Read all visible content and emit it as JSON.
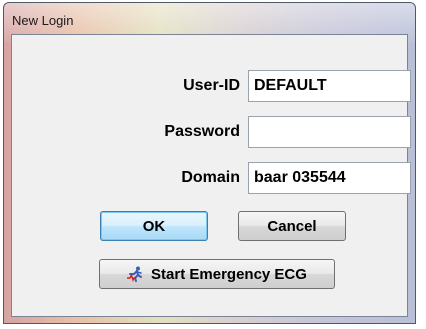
{
  "window": {
    "title": "New Login"
  },
  "form": {
    "userid": {
      "label": "User-ID",
      "value": "DEFAULT"
    },
    "password": {
      "label": "Password",
      "value": ""
    },
    "domain": {
      "label": "Domain",
      "value": "baar 035544"
    }
  },
  "buttons": {
    "ok": "OK",
    "cancel": "Cancel",
    "emergency": "Start Emergency ECG"
  },
  "icons": {
    "emergency": "ecg-runner-icon",
    "annotation": "arrow-right-icon"
  },
  "colors": {
    "default_button_border": "#3c7fb1",
    "dialog_background": "#f0f0f0"
  }
}
